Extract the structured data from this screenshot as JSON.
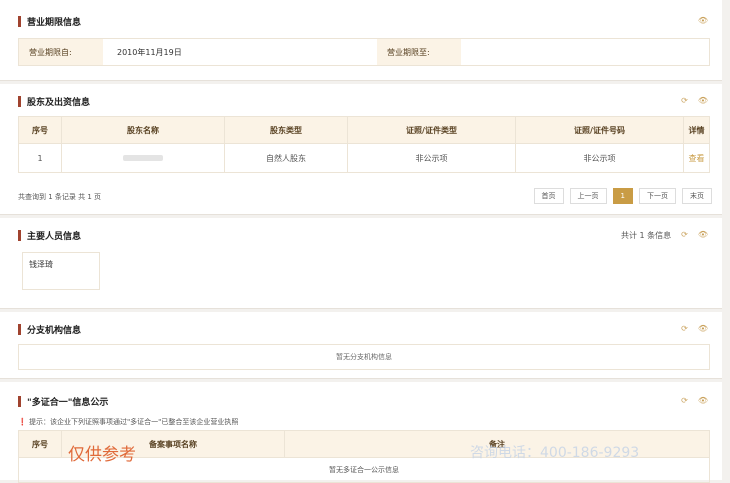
{
  "business_period": {
    "title": "营业期限信息",
    "from_label": "营业期限自:",
    "from_value": "2010年11月19日",
    "to_label": "营业期限至:"
  },
  "shareholders": {
    "title": "股东及出资信息",
    "columns": [
      "序号",
      "股东名称",
      "股东类型",
      "证照/证件类型",
      "证照/证件号码",
      "详情"
    ],
    "rows": [
      {
        "no": "1",
        "name": "",
        "type": "自然人股东",
        "id_type": "非公示项",
        "id_no": "非公示项",
        "detail": "查看"
      }
    ],
    "summary": "共查询到 1 条记录 共 1 页",
    "pager": [
      "首页",
      "上一页",
      "1",
      "下一页",
      "末页"
    ]
  },
  "personnel": {
    "title": "主要人员信息",
    "count": "共计 1 条信息",
    "person": "钱泽琦"
  },
  "branches": {
    "title": "分支机构信息",
    "empty": "暂无分支机构信息"
  },
  "multi_cert": {
    "title": "\"多证合一\"信息公示",
    "tip": "提示：该企业下列证照事项通过\"多证合一\"已整合至该企业营业执照",
    "columns": [
      "序号",
      "备案事项名称",
      "备注"
    ],
    "empty": "暂无多证合一公示信息"
  },
  "overlay": {
    "stamp": "仅供参考",
    "phone": "咨询电话：400-186-9293"
  },
  "colors": {
    "accent": "#a0432f",
    "gold": "#c99c45",
    "header_bg": "#fbf3e6"
  }
}
